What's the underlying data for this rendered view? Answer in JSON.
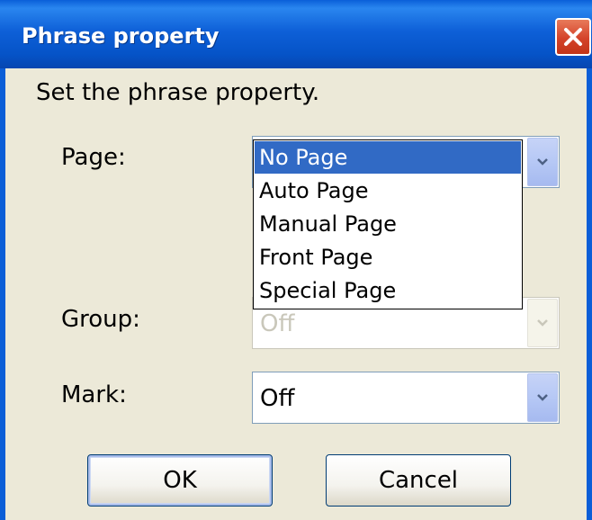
{
  "window": {
    "title": "Phrase property",
    "prompt": "Set the phrase property."
  },
  "fields": {
    "page": {
      "label": "Page:",
      "value": "No Page"
    },
    "group": {
      "label": "Group:",
      "value": "Off"
    },
    "mark": {
      "label": "Mark:",
      "value": "Off"
    }
  },
  "page_dropdown": {
    "options": [
      "No Page",
      "Auto Page",
      "Manual Page",
      "Front Page",
      "Special Page"
    ],
    "selected": "No Page"
  },
  "buttons": {
    "ok_label": "OK",
    "cancel_label": "Cancel"
  },
  "colors": {
    "title_bar": "#0553c7",
    "selection": "#316ac5",
    "dialog_bg": "#ece9d8",
    "close_button": "#d4432a"
  },
  "icons": {
    "close": "close-icon",
    "dropdown_arrow": "chevron-down-icon"
  }
}
